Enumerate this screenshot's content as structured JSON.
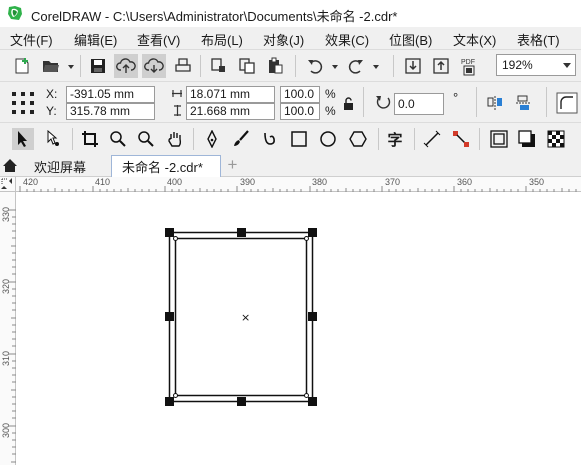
{
  "window": {
    "title": "CorelDRAW - C:\\Users\\Administrator\\Documents\\未命名 -2.cdr*",
    "logo_icon": "coreldraw-logo-icon"
  },
  "menu": [
    {
      "label": "文件(F)"
    },
    {
      "label": "编辑(E)"
    },
    {
      "label": "查看(V)"
    },
    {
      "label": "布局(L)"
    },
    {
      "label": "对象(J)"
    },
    {
      "label": "效果(C)"
    },
    {
      "label": "位图(B)"
    },
    {
      "label": "文本(X)"
    },
    {
      "label": "表格(T)"
    }
  ],
  "standard_toolbar": {
    "zoom_value": "192%",
    "pdf_label": "PDF"
  },
  "property_bar": {
    "x_label": "X:",
    "x_value": "-391.05 mm",
    "y_label": "Y:",
    "y_value": "315.78 mm",
    "width_value": "18.071 mm",
    "height_value": "21.668 mm",
    "scale_x": "100.0",
    "scale_y": "100.0",
    "percent_symbol": "%",
    "rotation_value": "0.0",
    "degree_symbol": "°"
  },
  "toolbox": {
    "text_tool_glyph": "字"
  },
  "tabs": [
    {
      "label": "欢迎屏幕",
      "active": false
    },
    {
      "label": "未命名 -2.cdr*",
      "active": true
    }
  ],
  "tab_add_label": "+",
  "ruler": {
    "h_labels": [
      "420",
      "410",
      "400",
      "390",
      "380",
      "370",
      "360",
      "350"
    ],
    "v_labels": [
      "330",
      "320",
      "310",
      "300"
    ]
  },
  "selection": {
    "center_marker": "×"
  }
}
